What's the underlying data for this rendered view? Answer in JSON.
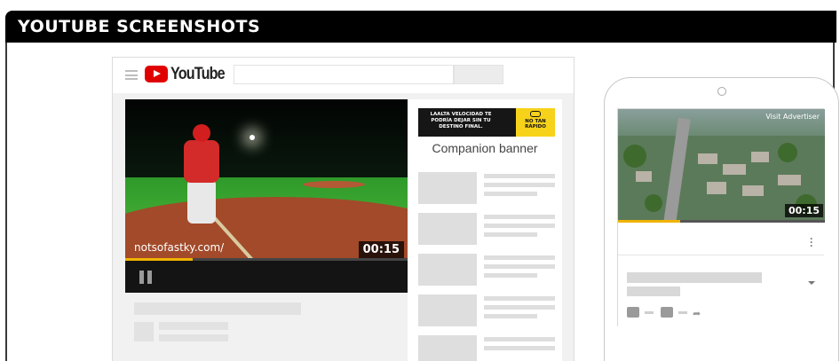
{
  "header": {
    "title": "YOUTUBE SCREENSHOTS"
  },
  "desktop": {
    "logo_text": "YouTube",
    "player": {
      "watermark": "notsofastky.com/",
      "time": "00:15",
      "progress": 0.24
    },
    "ad": {
      "headline": "LAALTA VELOCIDAD TE PODRÍA DEJAR SIN TU DESTINO FINAL.",
      "brand": "NO TAN RÁPIDO"
    },
    "companion_label": "Companion banner"
  },
  "mobile": {
    "visit_label": "Visit Advertiser",
    "time": "00:15",
    "progress": 0.3
  },
  "colors": {
    "header_bg": "#000000",
    "youtube_red": "#e00000",
    "progress": "#f0b400",
    "ad_yellow": "#f7d21a"
  }
}
